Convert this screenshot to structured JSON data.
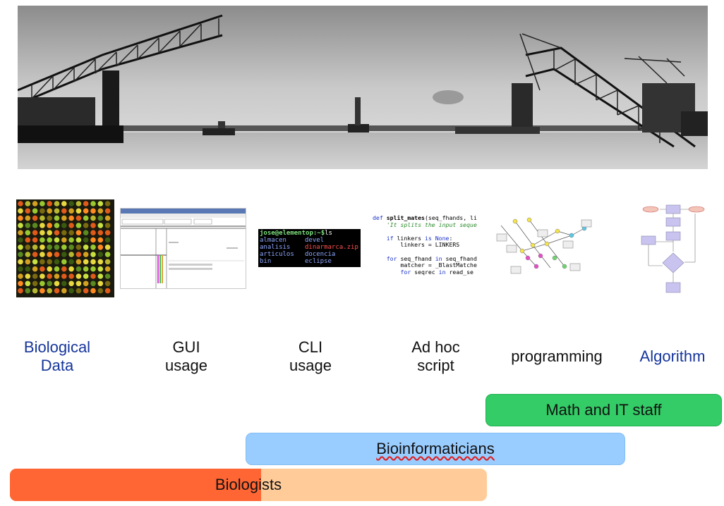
{
  "photo": {
    "description_icon": "bridge-photo"
  },
  "cli": {
    "prompt": "jose@elementop:~$",
    "command": " ls",
    "rows": [
      [
        "almacen",
        "devel"
      ],
      [
        "analisis",
        "dinarmarca.zip"
      ],
      [
        "articulos",
        "docencia"
      ],
      [
        "bin",
        "eclipse"
      ]
    ]
  },
  "steps": {
    "bio": {
      "line1": "Biological",
      "line2": "Data"
    },
    "gui": {
      "line1": "GUI",
      "line2": "usage"
    },
    "cli": {
      "line1": "CLI",
      "line2": "usage"
    },
    "adhoc": {
      "line1": "Ad hoc",
      "line2": "script"
    },
    "prog": {
      "line1": "programming"
    },
    "algo": {
      "line1": "Algorithm"
    }
  },
  "bars": {
    "math": "Math and IT staff",
    "bioinf": "Bioinformaticians",
    "biol": "Biologists"
  },
  "colors": {
    "blue_label": "#16359b",
    "math_bar": "#33cc66",
    "bioinf_bar": "#99ccff",
    "biol_light": "#ffcc99",
    "biol_dark": "#ff6633"
  }
}
